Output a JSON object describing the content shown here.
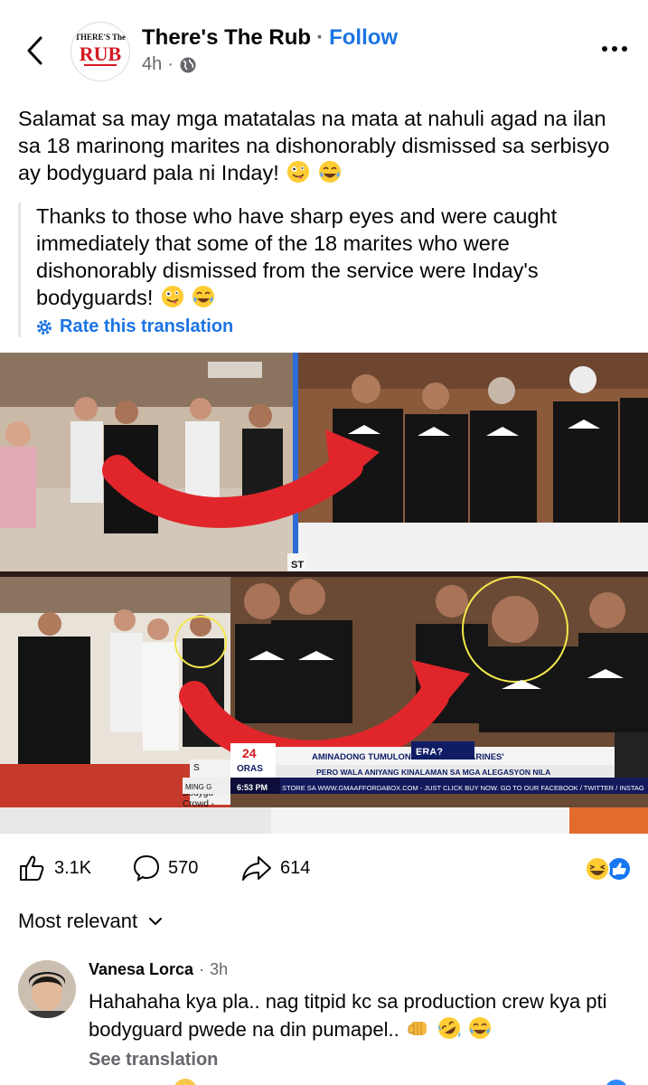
{
  "header": {
    "back_icon": "chevron-left-icon",
    "page_name": "There's The Rub",
    "separator": "·",
    "follow_label": "Follow",
    "time": "4h",
    "audience_icon": "globe-icon",
    "logo_text_top": "THERE'S The",
    "logo_text_main": "RUB",
    "more_icon": "more-horizontal-icon"
  },
  "post": {
    "text": "Salamat sa may mga matatalas na mata at nahuli agad na ilan sa 18 marinong marites na dishonorably dismissed sa serbisyo ay bodyguard pala ni Inday!",
    "translation": "Thanks to those who have sharp eyes and were caught immediately that some of the 18 marites who were dishonorably dismissed from the service were Inday's bodyguards!",
    "rate_translation_label": "Rate this translation",
    "emoji_icons": [
      "zany-face-icon",
      "tears-of-joy-icon"
    ]
  },
  "image": {
    "caption_line1": "AMINADONG TUMULONG SA '18 EX-MARINES'",
    "caption_line2": "PERO WALA ANIYANG KINALAMAN SA MGA ALEGASYON NILA",
    "logo_24": "24",
    "logo_oras": "ORAS",
    "time": "6:53 PM",
    "ticker": "STORE SA WWW.GMAAFFORDABOX.COM - JUST CLICK BUY NOW. GO TO OUR FACEBOOK / TWITTER / INSTAG",
    "era_label": "ERA?",
    "bodyguard_label": "Bodygu",
    "crowd_label": "Crowd -",
    "ming_label": "MING G",
    "st_label": "ST",
    "s_label": "S"
  },
  "reactions": {
    "like_count": "3.1K",
    "comment_count": "570",
    "share_count": "614",
    "reaction_icons": [
      "haha-reaction-icon",
      "like-reaction-icon"
    ]
  },
  "sort": {
    "label": "Most relevant"
  },
  "comment": {
    "author": "Vanesa Lorca",
    "separator": "·",
    "time": "3h",
    "text": "Hahahaha kya pla.. nag titpid kc sa production crew kya pti bodyguard pwede na din pumapel..",
    "emoji_icons": [
      "fist-bump-icon",
      "rolling-laugh-icon",
      "tears-of-joy-icon"
    ],
    "see_translation_label": "See translation"
  }
}
